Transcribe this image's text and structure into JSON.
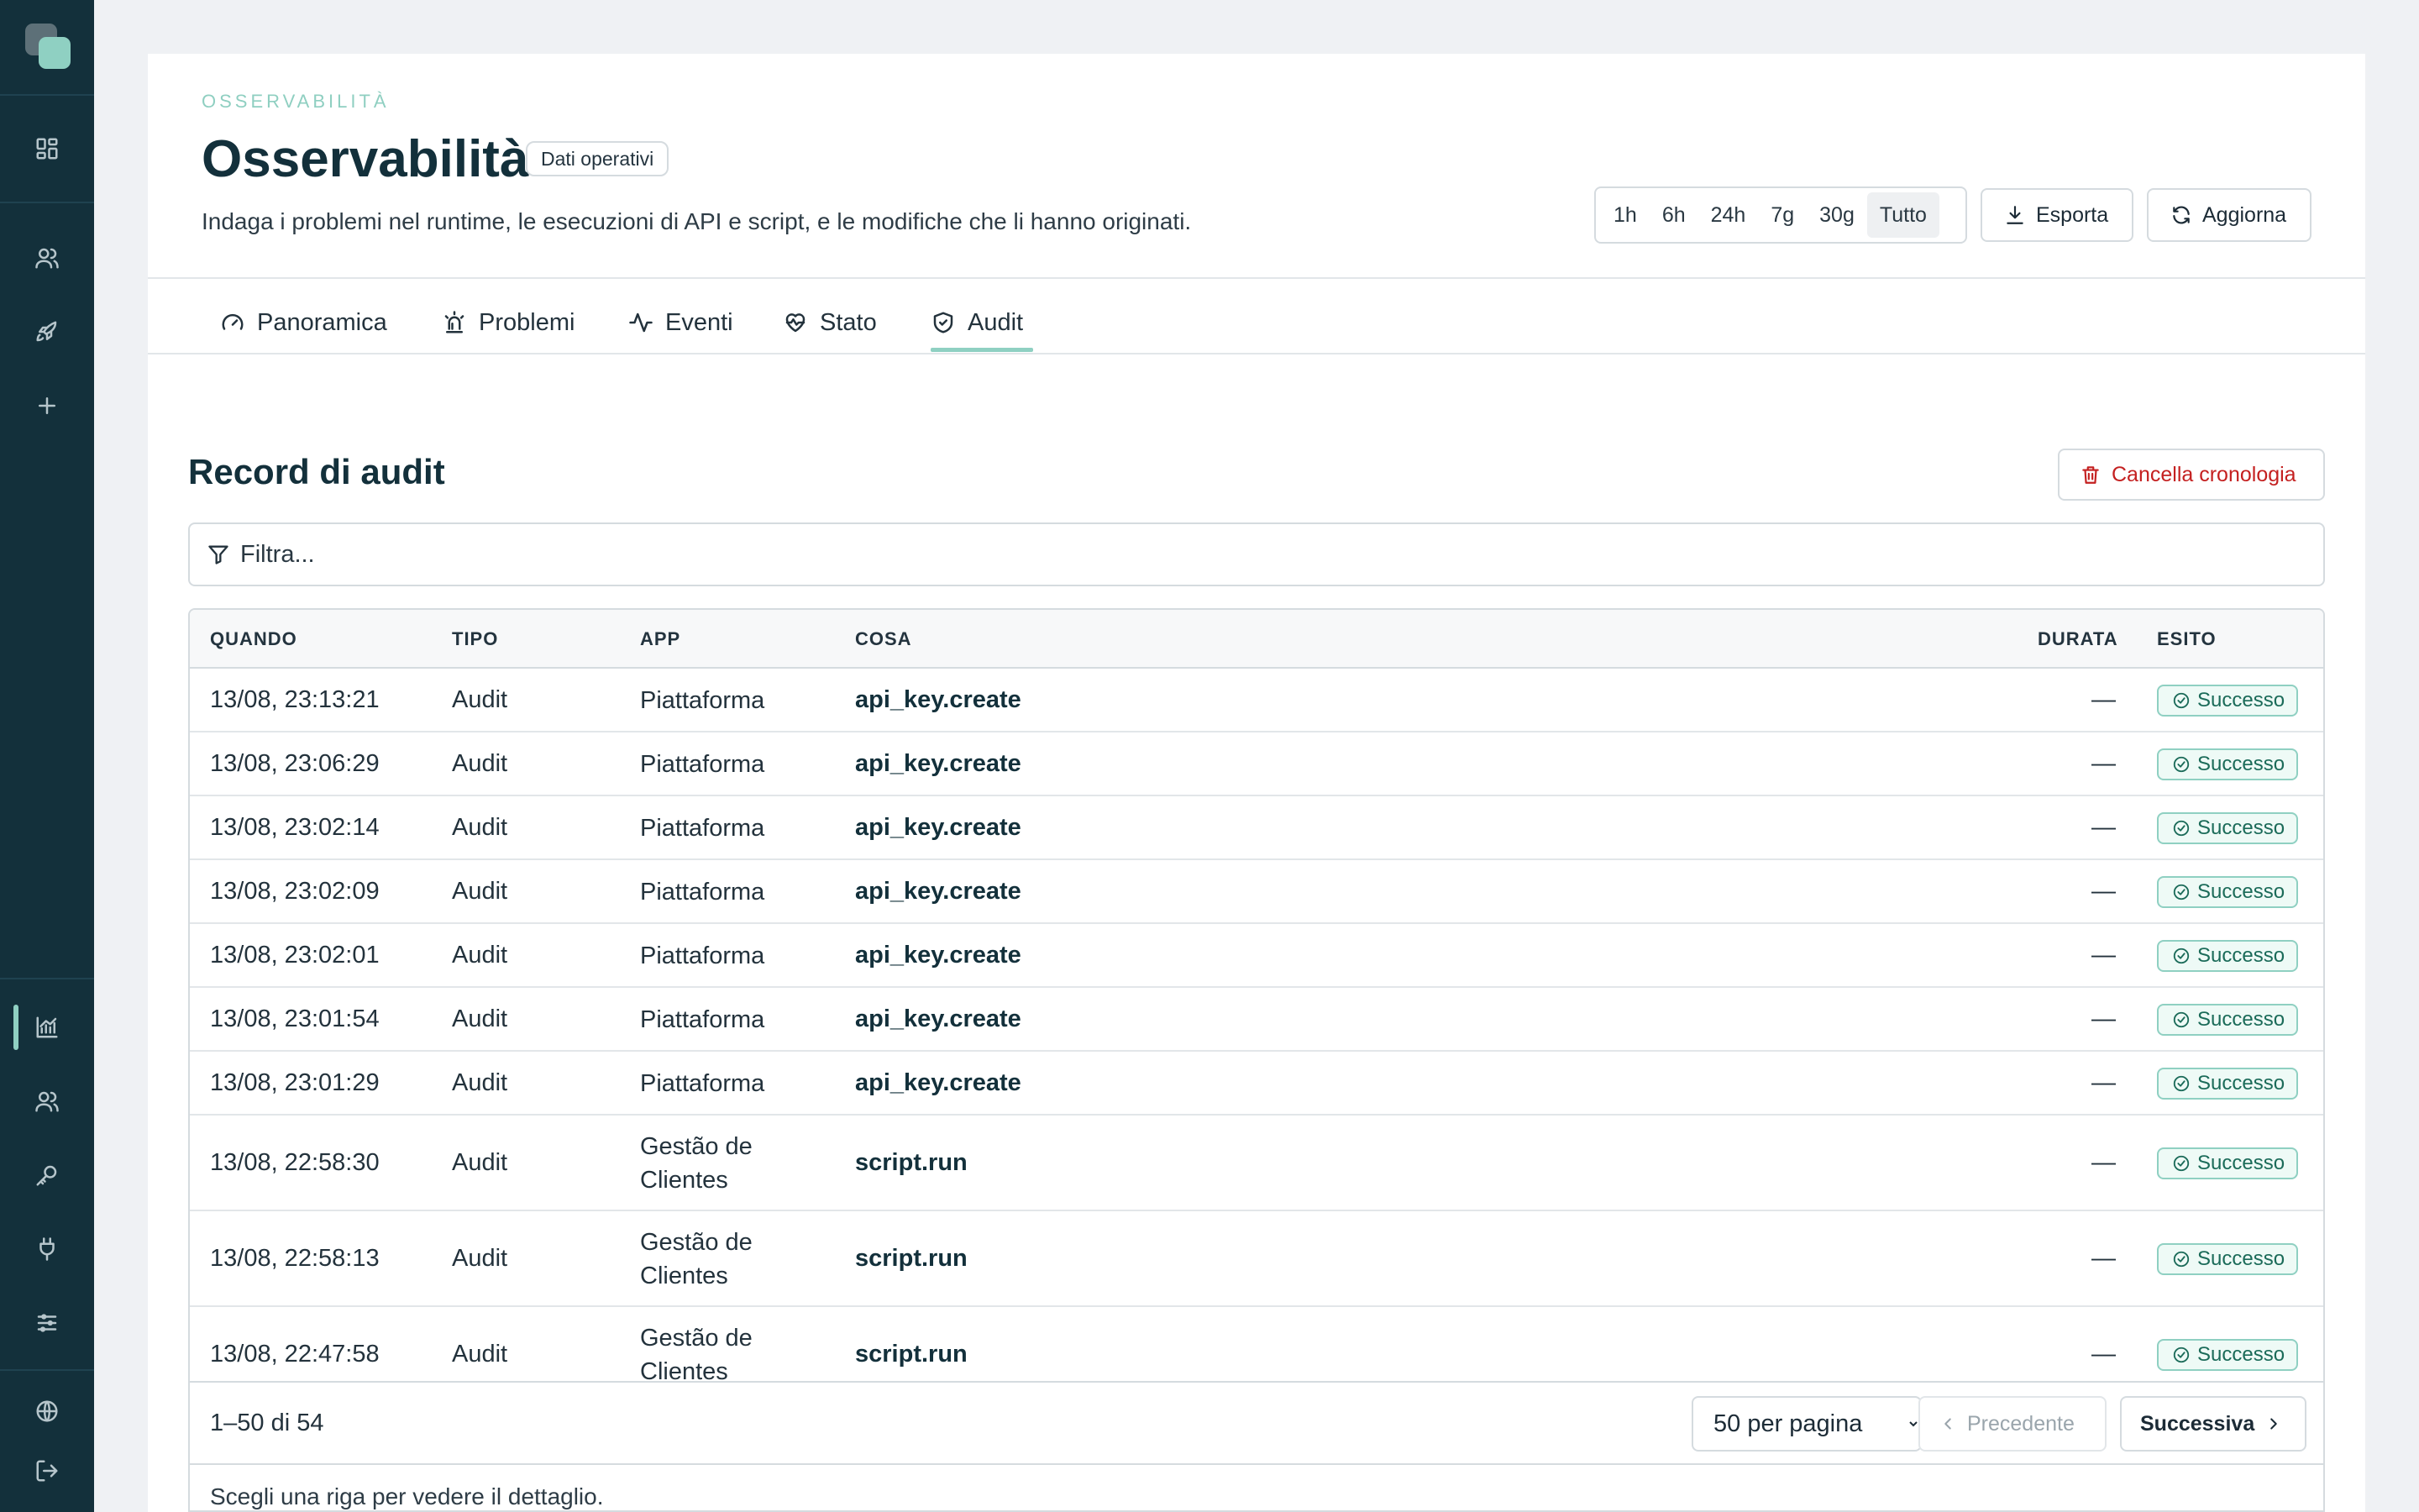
{
  "header": {
    "eyebrow": "OSSERVABILITÀ",
    "title": "Osservabilità",
    "badge": "Dati operativi",
    "subtitle": "Indaga i problemi nel runtime, le esecuzioni di API e script, e le modifiche che li hanno originati."
  },
  "time_range": {
    "options": [
      "1h",
      "6h",
      "24h",
      "7g",
      "30g",
      "Tutto"
    ],
    "selected": "Tutto"
  },
  "actions": {
    "export": "Esporta",
    "refresh": "Aggiorna"
  },
  "tabs": [
    {
      "label": "Panoramica",
      "icon": "gauge-icon"
    },
    {
      "label": "Problemi",
      "icon": "siren-icon"
    },
    {
      "label": "Eventi",
      "icon": "activity-icon"
    },
    {
      "label": "Stato",
      "icon": "heart-pulse-icon"
    },
    {
      "label": "Audit",
      "icon": "shield-check-icon"
    }
  ],
  "active_tab": "Audit",
  "section": {
    "title": "Record di audit",
    "clear_button": "Cancella cronologia",
    "filter_placeholder": "Filtra..."
  },
  "table": {
    "columns": {
      "when": "QUANDO",
      "type": "TIPO",
      "app": "APP",
      "what": "COSA",
      "duration": "DURATA",
      "outcome": "ESITO"
    },
    "rows": [
      {
        "when": "13/08, 23:13:21",
        "type": "Audit",
        "app": "Piattaforma",
        "what": "api_key.create",
        "duration": "—",
        "outcome": "Successo"
      },
      {
        "when": "13/08, 23:06:29",
        "type": "Audit",
        "app": "Piattaforma",
        "what": "api_key.create",
        "duration": "—",
        "outcome": "Successo"
      },
      {
        "when": "13/08, 23:02:14",
        "type": "Audit",
        "app": "Piattaforma",
        "what": "api_key.create",
        "duration": "—",
        "outcome": "Successo"
      },
      {
        "when": "13/08, 23:02:09",
        "type": "Audit",
        "app": "Piattaforma",
        "what": "api_key.create",
        "duration": "—",
        "outcome": "Successo"
      },
      {
        "when": "13/08, 23:02:01",
        "type": "Audit",
        "app": "Piattaforma",
        "what": "api_key.create",
        "duration": "—",
        "outcome": "Successo"
      },
      {
        "when": "13/08, 23:01:54",
        "type": "Audit",
        "app": "Piattaforma",
        "what": "api_key.create",
        "duration": "—",
        "outcome": "Successo"
      },
      {
        "when": "13/08, 23:01:29",
        "type": "Audit",
        "app": "Piattaforma",
        "what": "api_key.create",
        "duration": "—",
        "outcome": "Successo"
      },
      {
        "when": "13/08, 22:58:30",
        "type": "Audit",
        "app": "Gestão de Clientes",
        "what": "script.run",
        "duration": "—",
        "outcome": "Successo"
      },
      {
        "when": "13/08, 22:58:13",
        "type": "Audit",
        "app": "Gestão de Clientes",
        "what": "script.run",
        "duration": "—",
        "outcome": "Successo"
      },
      {
        "when": "13/08, 22:47:58",
        "type": "Audit",
        "app": "Gestão de Clientes",
        "what": "script.run",
        "duration": "—",
        "outcome": "Successo"
      }
    ]
  },
  "pagination": {
    "count": "1–50 di 54",
    "per_page": "50 per pagina",
    "prev": "Precedente",
    "next": "Successiva"
  },
  "detail_hint": "Scegli una riga per vedere il dettaglio.",
  "sidebar": {
    "icons": [
      "dashboard-icon",
      "users-icon",
      "rocket-icon",
      "plus-icon",
      "chart-icon",
      "team-icon",
      "key-icon",
      "plug-icon",
      "sliders-icon",
      "globe-icon",
      "logout-icon"
    ],
    "active": "chart-icon"
  },
  "colors": {
    "accent": "#8fd0c2",
    "sidebar": "#13303b",
    "danger": "#c42020",
    "success": "#1b6b59"
  }
}
